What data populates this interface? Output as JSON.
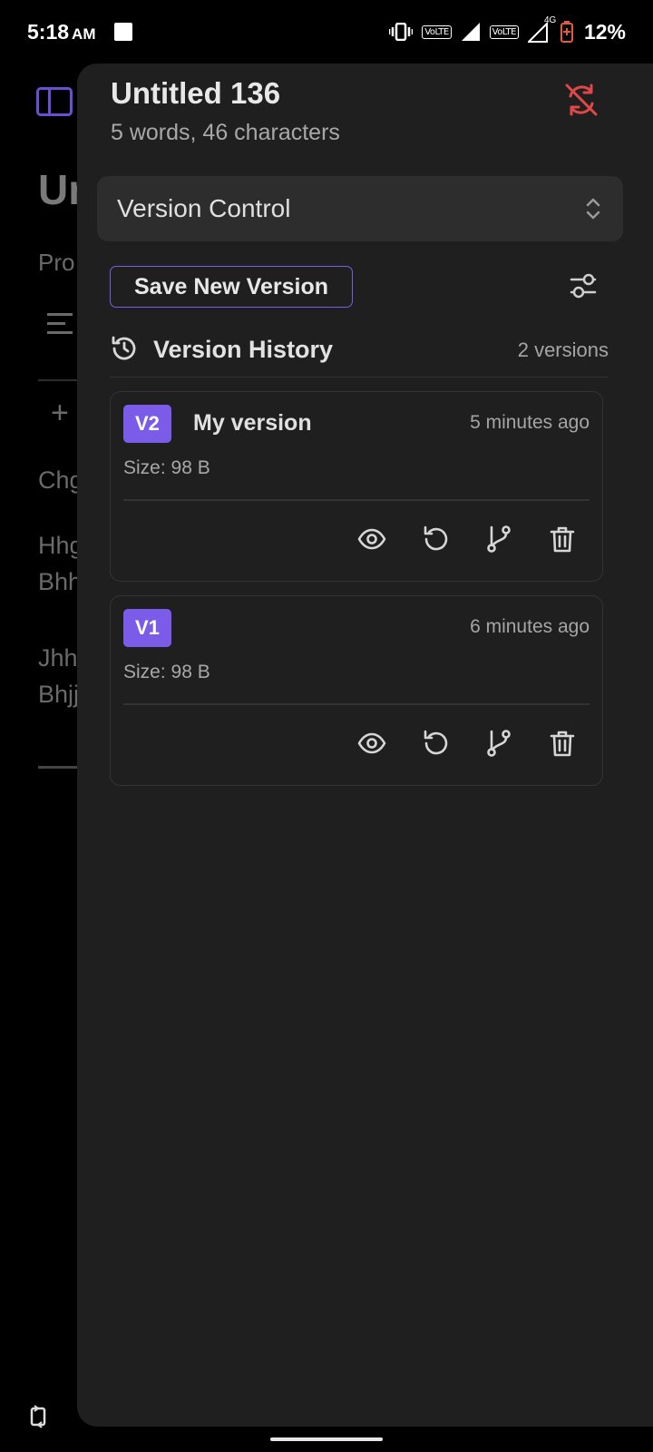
{
  "status_bar": {
    "time": "5:18",
    "ampm": "AM",
    "volte1": "VoLTE",
    "volte2": "VoLTE",
    "network": "4G",
    "battery": "12%"
  },
  "background_editor": {
    "title_fragment": "Un",
    "subtitle_fragment": "Pro",
    "lines": [
      "Chg",
      "Hhg",
      "Bhh",
      "Jhh",
      "Bhjj"
    ],
    "plus": "+"
  },
  "drawer": {
    "doc_title": "Untitled 136",
    "doc_stats": "5 words, 46 characters",
    "mode_select_value": "Version Control",
    "save_button_label": "Save New Version",
    "history_title": "Version History",
    "history_count": "2 versions",
    "versions": [
      {
        "badge": "V2",
        "name": "My version",
        "time": "5 minutes ago",
        "size": "Size: 98 B"
      },
      {
        "badge": "V1",
        "name": "",
        "time": "6 minutes ago",
        "size": "Size: 98 B"
      }
    ]
  },
  "colors": {
    "accent": "#7b5ce8",
    "sync_off": "#e04848",
    "panel_bg": "#1f1f1f"
  },
  "icons": {
    "sync": "sync-off-icon",
    "settings": "sliders-icon",
    "history": "history-icon",
    "actions": [
      "eye-icon",
      "restore-icon",
      "branch-icon",
      "trash-icon"
    ]
  }
}
